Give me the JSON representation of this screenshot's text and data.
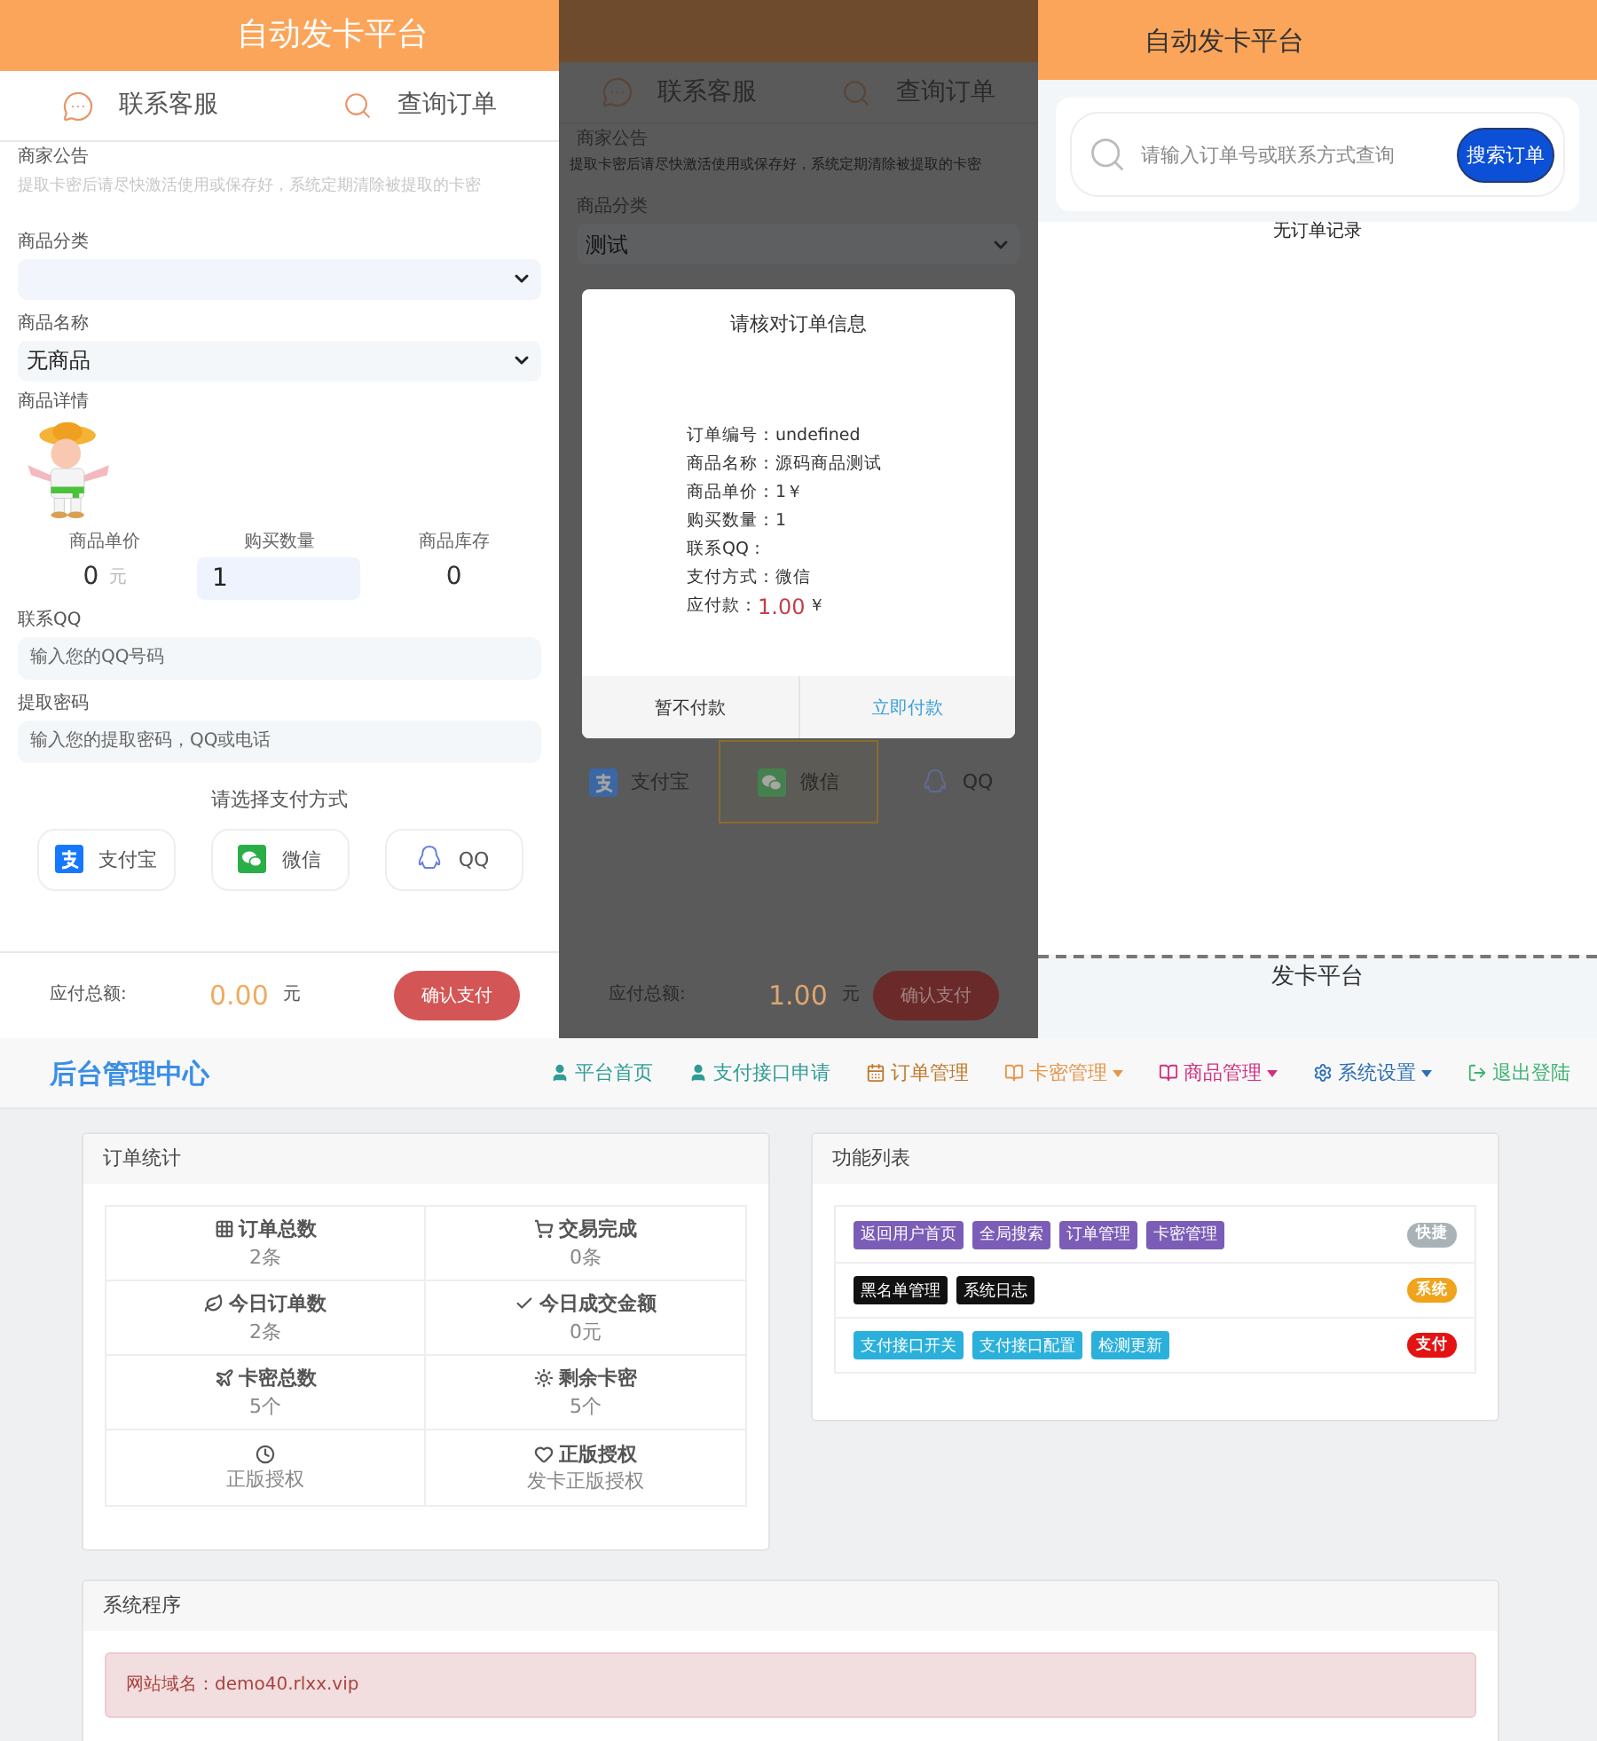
{
  "shop_page": {
    "title": "自动发卡平台",
    "nav": [
      {
        "label": "联系客服",
        "kind": "chat"
      },
      {
        "label": "查询订单",
        "kind": "search"
      }
    ],
    "notice": {
      "label": "商家公告",
      "text": "提取卡密后请尽快激活使用或保存好，系统定期清除被提取的卡密"
    },
    "category": {
      "label": "商品分类"
    },
    "product": {
      "label": "商品名称",
      "value": "无商品"
    },
    "details_label": "商品详情",
    "stats": [
      {
        "label": "商品单价",
        "value": "0",
        "unit": "元",
        "kind": "text"
      },
      {
        "label": "购买数量",
        "value": "1",
        "kind": "input"
      },
      {
        "label": "商品库存",
        "value": "0",
        "kind": "text"
      }
    ],
    "contact": {
      "label": "联系QQ",
      "placeholder": "输入您的QQ号码"
    },
    "password": {
      "label": "提取密码",
      "placeholder": "输入您的提取密码，QQ或电话"
    },
    "pay_prompt": "请选择支付方式",
    "payments": [
      {
        "label": "支付宝",
        "kind": "alipay",
        "selected": false
      },
      {
        "label": "微信",
        "kind": "wechat",
        "selected": false
      },
      {
        "label": "QQ",
        "kind": "qq",
        "selected": false
      }
    ],
    "total": {
      "label": "应付总额:",
      "amount": "0.00",
      "unit": "元"
    },
    "submit": "确认支付"
  },
  "dialog_page": {
    "nav": [
      {
        "label": "联系客服",
        "kind": "chat"
      },
      {
        "label": "查询订单",
        "kind": "search"
      }
    ],
    "notice": {
      "label": "商家公告",
      "text": "提取卡密后请尽快激活使用或保存好，系统定期清除被提取的卡密"
    },
    "category": {
      "label": "商品分类",
      "value": "测试"
    },
    "dialog": {
      "title": "请核对订单信息",
      "rows": [
        {
          "label": "订单编号：",
          "value": "undefined",
          "kind": "plain"
        },
        {
          "label": "商品名称：",
          "value": "源码商品测试",
          "kind": "plain"
        },
        {
          "label": "商品单价：",
          "value": "1￥",
          "kind": "plain"
        },
        {
          "label": "购买数量：",
          "value": "1",
          "kind": "plain"
        },
        {
          "label": "联系QQ：",
          "kind": "plain"
        },
        {
          "label": "支付方式：",
          "value": "微信",
          "kind": "plain"
        },
        {
          "label": "应付款：",
          "value": "1.00",
          "unit": "￥",
          "kind": "amount"
        }
      ],
      "buttons": [
        {
          "label": "暂不付款",
          "kind": "cancel"
        },
        {
          "label": "立即付款",
          "kind": "confirm"
        }
      ]
    },
    "payments": [
      {
        "label": "支付宝",
        "kind": "alipay",
        "selected": false
      },
      {
        "label": "微信",
        "kind": "wechat",
        "selected": true
      },
      {
        "label": "QQ",
        "kind": "qq",
        "selected": false
      }
    ],
    "total": {
      "label": "应付总额:",
      "amount": "1.00",
      "unit": "元"
    },
    "submit": "确认支付"
  },
  "query_page": {
    "title": "自动发卡平台",
    "search": {
      "placeholder": "请输入订单号或联系方式查询",
      "button": "搜索订单"
    },
    "empty": "无订单记录",
    "footer": "发卡平台"
  },
  "admin": {
    "brand": "后台管理中心",
    "nav": [
      {
        "label": "平台首页",
        "kind": "user",
        "color": "#2f9c95",
        "dropdown": false
      },
      {
        "label": "支付接口申请",
        "kind": "user",
        "color": "#2f9c95",
        "dropdown": false
      },
      {
        "label": "订单管理",
        "kind": "calendar",
        "color": "#c0782a",
        "dropdown": false
      },
      {
        "label": "卡密管理",
        "kind": "book",
        "color": "#e8954a",
        "dropdown": true
      },
      {
        "label": "商品管理",
        "kind": "book",
        "color": "#d0307f",
        "dropdown": true
      },
      {
        "label": "系统设置",
        "kind": "gear",
        "color": "#2d6fb5",
        "dropdown": true
      },
      {
        "label": "退出登陆",
        "kind": "logout",
        "color": "#3cb371",
        "dropdown": false
      }
    ],
    "stats": {
      "title": "订单统计",
      "cells": [
        {
          "kind": "grid",
          "label": "订单总数",
          "value": "2条"
        },
        {
          "kind": "cart",
          "label": "交易完成",
          "value": "0条"
        },
        {
          "kind": "leaf",
          "label": "今日订单数",
          "value": "2条"
        },
        {
          "kind": "check",
          "label": "今日成交金额",
          "value": "0元"
        },
        {
          "kind": "plane",
          "label": "卡密总数",
          "value": "5个"
        },
        {
          "kind": "sun",
          "label": "剩余卡密",
          "value": "5个"
        },
        {
          "kind": "clock",
          "value": "正版授权"
        },
        {
          "kind": "heart",
          "label": "正版授权",
          "value": "发卡正版授权"
        }
      ]
    },
    "functions": {
      "title": "功能列表",
      "groups": [
        {
          "buttons": [
            "返回用户首页",
            "全局搜索",
            "订单管理",
            "卡密管理"
          ],
          "kind": "quick",
          "tag": "快捷",
          "color": "#a9b3b7"
        },
        {
          "buttons": [
            "黑名单管理",
            "系统日志"
          ],
          "kind": "system",
          "tag": "系统",
          "color": "#f0a31c"
        },
        {
          "buttons": [
            "支付接口开关",
            "支付接口配置",
            "检测更新"
          ],
          "kind": "pay",
          "tag": "支付",
          "color": "#e31313"
        }
      ]
    },
    "system": {
      "title": "系统程序",
      "alert": "网站域名：demo40.rlxx.vip"
    }
  }
}
